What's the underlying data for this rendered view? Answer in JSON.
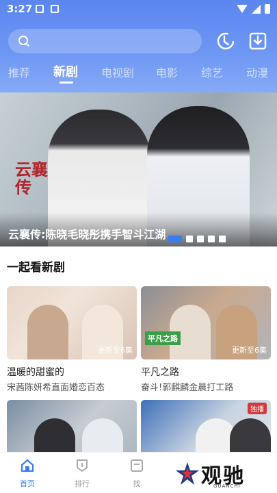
{
  "status_bar": {
    "time": "3:27"
  },
  "search": {
    "placeholder": ""
  },
  "tabs": [
    {
      "label": "推荐"
    },
    {
      "label": "新剧"
    },
    {
      "label": "电视剧"
    },
    {
      "label": "电影"
    },
    {
      "label": "综艺"
    },
    {
      "label": "动漫"
    }
  ],
  "banner": {
    "caption": "云襄传:陈晓毛晓彤携手智斗江湖",
    "seal_text": "云襄传",
    "dot_count": 5,
    "active_dot": 0
  },
  "section": {
    "title": "一起看新剧"
  },
  "cards": [
    {
      "title": "温暖的甜蜜的",
      "desc": "宋茜陈妍希直面婚恋百态",
      "badge": "更新至6集",
      "tag": ""
    },
    {
      "title": "平凡之路",
      "desc": "奋斗!郭麒麟金晨打工路",
      "badge": "更新至6集",
      "tag": "平凡之路"
    },
    {
      "title": "",
      "desc": "",
      "badge": "",
      "tag": ""
    },
    {
      "title": "",
      "desc": "",
      "badge": "",
      "tag": "独播"
    }
  ],
  "bottom_nav": [
    {
      "label": "首页",
      "icon": "home-icon",
      "active": true
    },
    {
      "label": "排行",
      "icon": "rank-icon",
      "active": false
    },
    {
      "label": "找",
      "icon": "find-icon",
      "active": false
    }
  ],
  "watermark": {
    "brand": "观驰",
    "sub": "GUANCHI"
  },
  "colors": {
    "accent": "#3a7df0",
    "header_top": "#5b86ef",
    "header_bottom": "#86aaf6"
  }
}
